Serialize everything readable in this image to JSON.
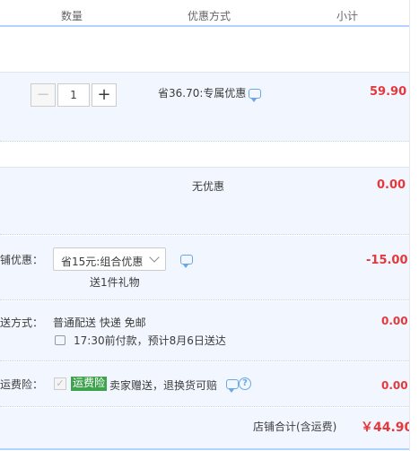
{
  "header": {
    "qty": "数量",
    "discount": "优惠方式",
    "subtotal": "小计"
  },
  "item": {
    "quantity": "1",
    "minus": "−",
    "plus": "+",
    "discount_text": "省36.70:专属优惠",
    "subtotal": "59.90"
  },
  "no_discount": {
    "text": "无优惠",
    "amount": "0.00"
  },
  "shop_discount": {
    "label": "铺优惠：",
    "selected": "省15元:组合优惠",
    "gift": "送1件礼物",
    "amount": "-15.00"
  },
  "shipping": {
    "label": "送方式：",
    "method": "普通配送 快递 免邮",
    "eta": "17:30前付款，预计8月6日送达",
    "amount": "0.00"
  },
  "insurance": {
    "label": "运费险：",
    "checkmark": "✓",
    "tag": "运费险",
    "desc": "卖家赠送，退换货可赔",
    "help": "?",
    "amount": "0.00"
  },
  "total": {
    "label": "店铺合计(含运费)",
    "amount": "￥44.90"
  },
  "colors": {
    "accent_blue": "#b2d1ff",
    "price_red": "#e4393c",
    "band_bg": "#f2f7ff",
    "tag_green": "#3fa34d"
  }
}
